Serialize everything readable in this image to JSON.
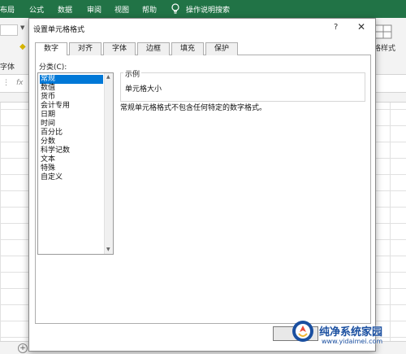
{
  "ribbon": {
    "tabs": [
      "布局",
      "公式",
      "数据",
      "审阅",
      "视图",
      "帮助"
    ],
    "tell_me": "操作说明搜索",
    "font_group_label": "字体",
    "cell_style_label": "格样式",
    "fx_label": "fx"
  },
  "dialog": {
    "title": "设置单元格格式",
    "help": "?",
    "close": "✕",
    "tabs": [
      "数字",
      "对齐",
      "字体",
      "边框",
      "填充",
      "保护"
    ],
    "active_tab": "数字",
    "category_label": "分类(C):",
    "categories": [
      "常规",
      "数值",
      "货币",
      "会计专用",
      "日期",
      "时间",
      "百分比",
      "分数",
      "科学记数",
      "文本",
      "特殊",
      "自定义"
    ],
    "selected_category": "常规",
    "sample_title": "示例",
    "sample_value": "单元格大小",
    "description": "常规单元格格式不包含任何特定的数字格式。"
  },
  "status_bar": {
    "add_sheet": "+"
  },
  "watermark": {
    "name": "纯净系统家园",
    "url": "www.yidaimei.com"
  },
  "colors": {
    "ribbon_green": "#217346",
    "selection_blue": "#0078d7",
    "watermark_blue": "#1a4fa0"
  }
}
